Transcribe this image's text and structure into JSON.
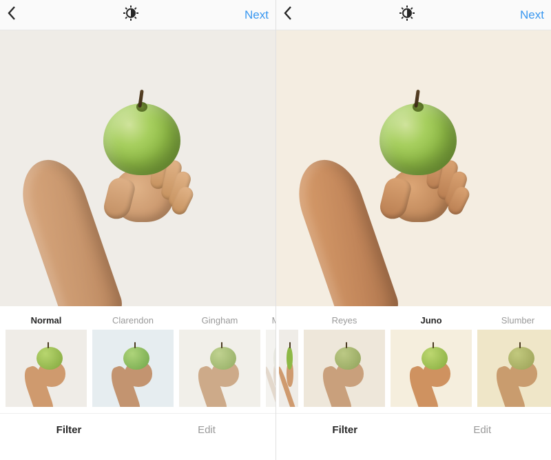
{
  "screens": [
    {
      "nav": {
        "next_label": "Next"
      },
      "filters": [
        {
          "name": "Normal",
          "tint": "t-normal",
          "selected": true
        },
        {
          "name": "Clarendon",
          "tint": "t-clarendon",
          "selected": false
        },
        {
          "name": "Gingham",
          "tint": "t-gingham",
          "selected": false
        },
        {
          "name": "M",
          "tint": "t-faded",
          "selected": false,
          "partial": "right"
        }
      ],
      "tabs": {
        "filter_label": "Filter",
        "edit_label": "Edit",
        "active": "filter"
      }
    },
    {
      "nav": {
        "next_label": "Next"
      },
      "filters": [
        {
          "name": "",
          "tint": "t-cut",
          "selected": false,
          "partial": "left"
        },
        {
          "name": "Reyes",
          "tint": "t-reyes",
          "selected": false
        },
        {
          "name": "Juno",
          "tint": "t-juno",
          "selected": true
        },
        {
          "name": "Slumber",
          "tint": "t-slumber",
          "selected": false
        },
        {
          "name": "",
          "tint": "t-cut",
          "selected": false,
          "partial": "right"
        }
      ],
      "tabs": {
        "filter_label": "Filter",
        "edit_label": "Edit",
        "active": "filter"
      }
    }
  ]
}
